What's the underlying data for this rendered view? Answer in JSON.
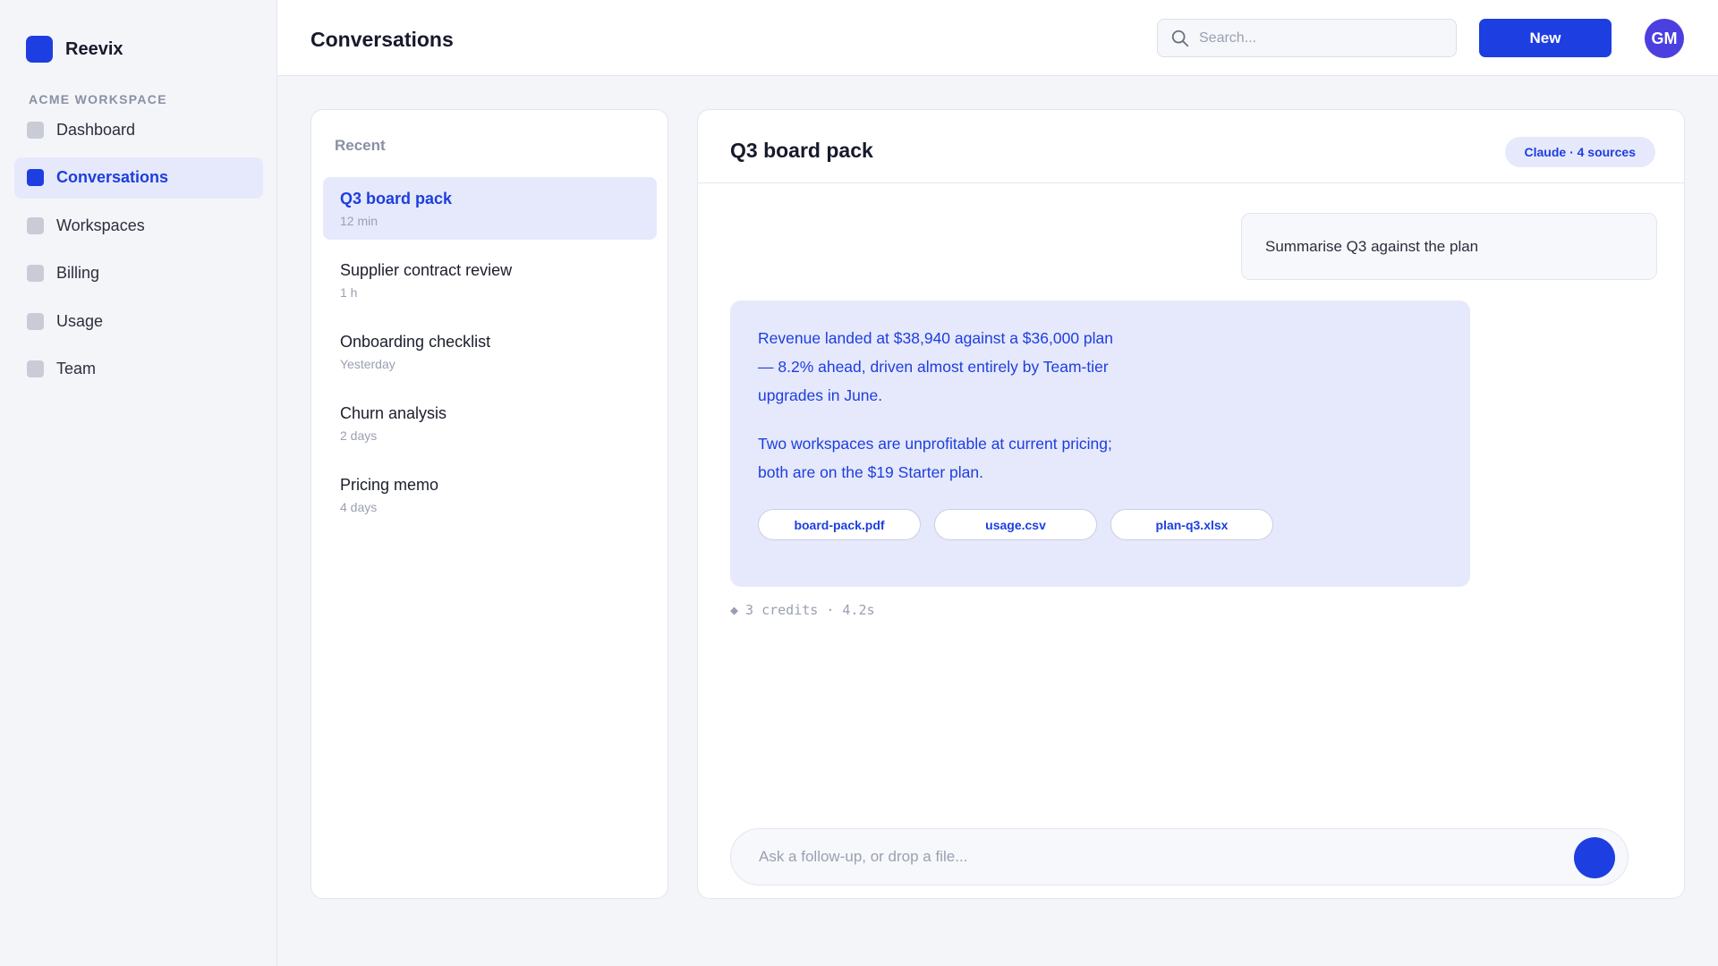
{
  "app": {
    "name": "Reevix"
  },
  "sidebar": {
    "workspace_label": "ACME WORKSPACE",
    "items": [
      {
        "label": "Dashboard",
        "active": false
      },
      {
        "label": "Conversations",
        "active": true
      },
      {
        "label": "Workspaces",
        "active": false
      },
      {
        "label": "Billing",
        "active": false
      },
      {
        "label": "Usage",
        "active": false
      },
      {
        "label": "Team",
        "active": false
      }
    ]
  },
  "header": {
    "title": "Conversations",
    "search_placeholder": "Search...",
    "new_label": "New",
    "avatar_initials": "GM"
  },
  "recent": {
    "title": "Recent",
    "items": [
      {
        "title": "Q3 board pack",
        "time": "12 min",
        "active": true
      },
      {
        "title": "Supplier contract review",
        "time": "1 h",
        "active": false
      },
      {
        "title": "Onboarding checklist",
        "time": "Yesterday",
        "active": false
      },
      {
        "title": "Churn analysis",
        "time": "2 days",
        "active": false
      },
      {
        "title": "Pricing memo",
        "time": "4 days",
        "active": false
      }
    ]
  },
  "conversation": {
    "title": "Q3 board pack",
    "badge": "Claude · 4 sources",
    "user_message": "Summarise Q3 against the plan",
    "assistant_paragraphs": [
      "Revenue landed at $38,940 against a $36,000 plan — 8.2% ahead, driven almost entirely by Team-tier upgrades in June.",
      "Two workspaces are unprofitable at current pricing; both are on the $19 Starter plan."
    ],
    "attachments": [
      "board-pack.pdf",
      "usage.csv",
      "plan-q3.xlsx"
    ],
    "meta_icon": "◆",
    "meta_text": "3 credits · 4.2s",
    "composer_placeholder": "Ask a follow-up, or drop a file..."
  },
  "colors": {
    "accent": "#1d3ee0",
    "accent_soft": "#e6e9fb",
    "avatar": "#4b3fe0",
    "background": "#f4f5f9"
  }
}
